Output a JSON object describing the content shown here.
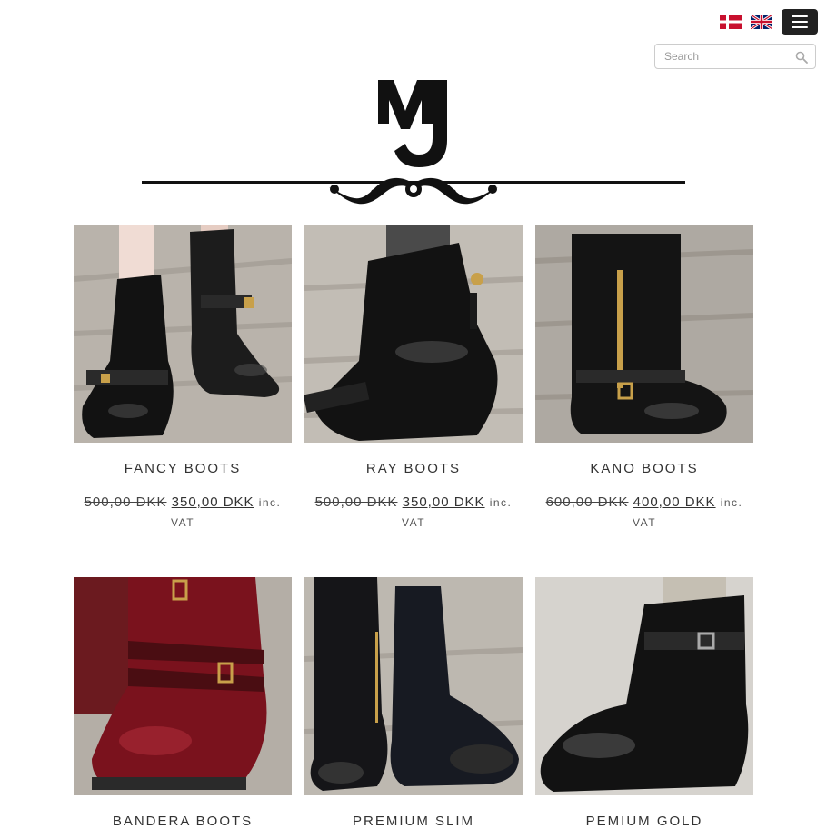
{
  "header": {
    "flags": [
      {
        "name": "danish-flag-icon",
        "lang": "Danish"
      },
      {
        "name": "uk-flag-icon",
        "lang": "English"
      }
    ],
    "menu_icon": "hamburger-menu-icon",
    "search": {
      "placeholder": "Search",
      "value": "",
      "icon": "search-icon"
    },
    "logo_text": "MJ"
  },
  "products": [
    {
      "name": "FANCY BOOTS",
      "old_price": "500,00 DKK",
      "new_price": "350,00 DKK",
      "vat": "inc. VAT"
    },
    {
      "name": "RAY BOOTS",
      "old_price": "500,00 DKK",
      "new_price": "350,00 DKK",
      "vat": "inc. VAT"
    },
    {
      "name": "KANO BOOTS",
      "old_price": "600,00 DKK",
      "new_price": "400,00 DKK",
      "vat": "inc. VAT"
    },
    {
      "name": "BANDERA BOOTS",
      "old_price": "",
      "new_price": "",
      "vat": ""
    },
    {
      "name": "PREMIUM SLIM",
      "old_price": "",
      "new_price": "",
      "vat": ""
    },
    {
      "name": "PEMIUM GOLD",
      "old_price": "",
      "new_price": "",
      "vat": ""
    }
  ],
  "colors": {
    "accent": "#222222",
    "background": "#ffffff",
    "text": "#333333"
  }
}
